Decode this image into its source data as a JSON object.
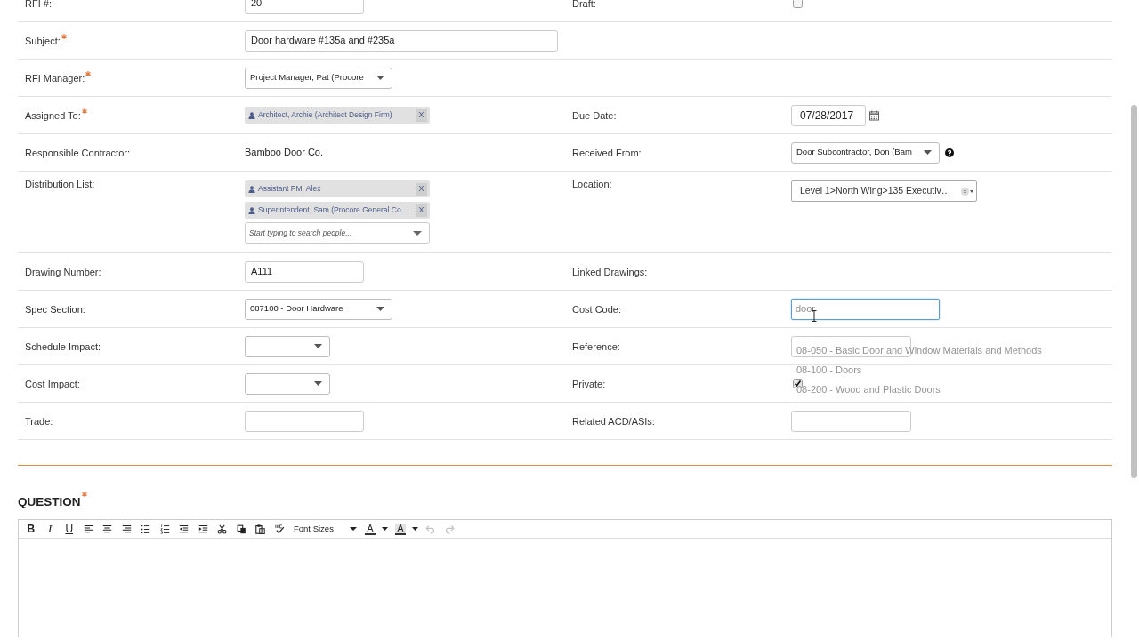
{
  "form": {
    "rows": [
      {
        "left": {
          "label": "RFI #:",
          "required": false,
          "field": {
            "kind": "text",
            "value": "20"
          }
        },
        "right": {
          "label": "Draft:",
          "required": false,
          "field": {
            "kind": "checkbox",
            "checked": false
          }
        }
      },
      {
        "left": {
          "label": "Subject:",
          "required": true,
          "field": {
            "kind": "text",
            "value": "Door hardware #135a and #235a"
          }
        }
      },
      {
        "left": {
          "label": "RFI Manager:",
          "required": true,
          "field": {
            "kind": "select",
            "value": "Project Manager, Pat (Procore"
          }
        }
      },
      {
        "left": {
          "label": "Assigned To:",
          "required": true,
          "field": {
            "kind": "tags",
            "tags": [
              {
                "label": "Architect, Archie (Architect Design Firm)",
                "remove": "X"
              }
            ]
          }
        },
        "right": {
          "label": "Due Date:",
          "required": false,
          "field": {
            "kind": "date",
            "value": "07/28/2017"
          }
        }
      },
      {
        "left": {
          "label": "Responsible Contractor:",
          "required": false,
          "field": {
            "kind": "plain",
            "value": "Bamboo Door Co."
          }
        },
        "right": {
          "label": "Received From:",
          "required": false,
          "field": {
            "kind": "select",
            "value": "Door Subcontractor, Don (Bam",
            "help": true
          }
        }
      },
      {
        "left": {
          "label": "Distribution List:",
          "required": false,
          "field": {
            "kind": "tags",
            "tags": [
              {
                "label": "Assistant PM, Alex",
                "remove": "X"
              },
              {
                "label": "Superintendent, Sam (Procore General Co...",
                "remove": "X"
              }
            ],
            "placeholder": "Start typing to search people..."
          }
        },
        "right": {
          "label": "Location:",
          "required": false,
          "field": {
            "kind": "location",
            "value": "Level 1>North Wing>135 Executiv…"
          }
        }
      },
      {
        "left": {
          "label": "Drawing Number:",
          "required": false,
          "field": {
            "kind": "text",
            "value": "A111"
          }
        },
        "right": {
          "label": "Linked Drawings:",
          "required": false
        }
      },
      {
        "left": {
          "label": "Spec Section:",
          "required": false,
          "field": {
            "kind": "select",
            "value": "087100 - Door Hardware"
          }
        },
        "right": {
          "label": "Cost Code:",
          "required": false,
          "field": {
            "kind": "search",
            "value": "door",
            "focused": true,
            "options": [
              {
                "label": "08-050 - Basic Door and Window Materials and Methods"
              },
              {
                "label": "08-100 - Doors"
              },
              {
                "label": "08-200 - Wood and Plastic Doors"
              }
            ]
          }
        }
      },
      {
        "left": {
          "label": "Schedule Impact:",
          "required": false,
          "field": {
            "kind": "select"
          }
        },
        "right": {
          "label": "Reference:",
          "required": false,
          "field": {
            "kind": "text"
          }
        }
      },
      {
        "left": {
          "label": "Cost Impact:",
          "required": false,
          "field": {
            "kind": "select"
          }
        },
        "right": {
          "label": "Private:",
          "required": false,
          "field": {
            "kind": "checkbox",
            "checked": true
          }
        }
      },
      {
        "left": {
          "label": "Trade:",
          "required": false,
          "field": {
            "kind": "text"
          }
        },
        "right": {
          "label": "Related ACD/ASIs:",
          "required": false,
          "field": {
            "kind": "text"
          }
        }
      }
    ]
  },
  "question": {
    "title": "QUESTION",
    "required": true,
    "toolbar": [
      {
        "kind": "bold",
        "label": "B",
        "disabled": false
      },
      {
        "kind": "italic",
        "label": "I",
        "disabled": false
      },
      {
        "kind": "underline",
        "label": "U",
        "disabled": false
      },
      {
        "kind": "align_left",
        "disabled": false
      },
      {
        "kind": "align_center",
        "disabled": false
      },
      {
        "kind": "align_right",
        "disabled": false
      },
      {
        "kind": "bullet_list",
        "disabled": false
      },
      {
        "kind": "numbered_list",
        "disabled": false
      },
      {
        "kind": "outdent",
        "disabled": false
      },
      {
        "kind": "indent",
        "disabled": false
      },
      {
        "kind": "cut",
        "disabled": false
      },
      {
        "kind": "copy",
        "disabled": false
      },
      {
        "kind": "paste",
        "disabled": false
      },
      {
        "kind": "spellcheck",
        "disabled": false
      },
      {
        "kind": "font_size",
        "label": "Font Sizes",
        "disabled": false
      },
      {
        "kind": "text_color",
        "label": "A",
        "disabled": false
      },
      {
        "kind": "highlight_color",
        "label": "A",
        "disabled": false
      },
      {
        "kind": "undo",
        "disabled": true
      },
      {
        "kind": "redo",
        "disabled": true
      }
    ]
  }
}
